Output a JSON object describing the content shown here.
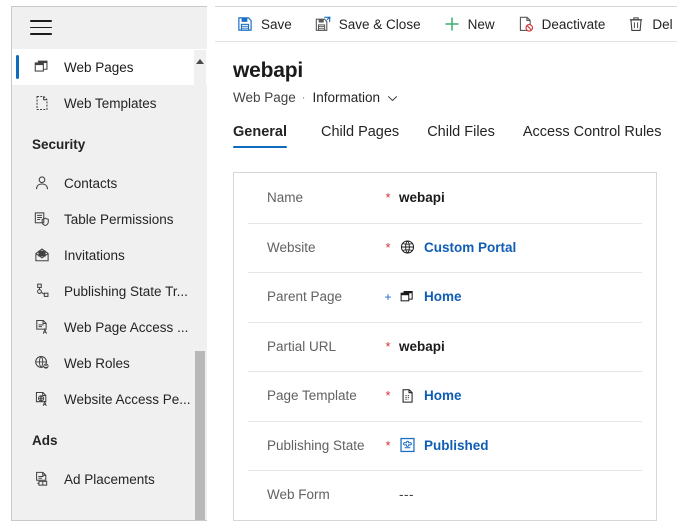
{
  "sidebar": {
    "menu_icon": "hamburger-icon",
    "items": [
      {
        "type": "item",
        "label": "Web Pages",
        "icon": "web-pages-icon",
        "selected": true
      },
      {
        "type": "item",
        "label": "Web Templates",
        "icon": "web-templates-icon",
        "selected": false
      },
      {
        "type": "group",
        "label": "Security"
      },
      {
        "type": "item",
        "label": "Contacts",
        "icon": "contact-person-icon",
        "selected": false
      },
      {
        "type": "item",
        "label": "Table  Permissions",
        "icon": "table-permissions-icon",
        "selected": false
      },
      {
        "type": "item",
        "label": "Invitations",
        "icon": "invitations-icon",
        "selected": false
      },
      {
        "type": "item",
        "label": "Publishing State Tr...",
        "icon": "publishing-state-transition-icon",
        "selected": false
      },
      {
        "type": "item",
        "label": "Web Page Access ...",
        "icon": "web-page-access-icon",
        "selected": false
      },
      {
        "type": "item",
        "label": "Web Roles",
        "icon": "web-roles-icon",
        "selected": false
      },
      {
        "type": "item",
        "label": "Website Access Pe...",
        "icon": "website-access-permission-icon",
        "selected": false
      },
      {
        "type": "group",
        "label": "Ads"
      },
      {
        "type": "item",
        "label": "Ad Placements",
        "icon": "ad-placements-icon",
        "selected": false
      }
    ],
    "scrollbar": {
      "up_arrow": "scroll-up-arrow-icon"
    }
  },
  "commandbar": {
    "buttons": [
      {
        "label": "Save",
        "icon": "save-icon"
      },
      {
        "label": "Save & Close",
        "icon": "save-and-close-icon"
      },
      {
        "label": "New",
        "icon": "plus-icon"
      },
      {
        "label": "Deactivate",
        "icon": "deactivate-icon"
      },
      {
        "label": "Del",
        "icon": "trash-icon"
      }
    ]
  },
  "record": {
    "title": "webapi",
    "entity": "Web Page",
    "separator": "·",
    "form_name": "Information",
    "form_chevron": "chevron-down-icon"
  },
  "tabs": [
    {
      "label": "General",
      "active": true
    },
    {
      "label": "Child Pages",
      "active": false
    },
    {
      "label": "Child Files",
      "active": false
    },
    {
      "label": "Access Control Rules",
      "active": false
    }
  ],
  "form": {
    "fields": [
      {
        "label": "Name",
        "marker": "*",
        "marker_type": "required",
        "value": "webapi",
        "value_type": "text",
        "icon": null
      },
      {
        "label": "Website",
        "marker": "*",
        "marker_type": "required",
        "value": "Custom Portal",
        "value_type": "lookup",
        "icon": "globe-icon"
      },
      {
        "label": "Parent Page",
        "marker": "+",
        "marker_type": "recommended",
        "value": "Home",
        "value_type": "lookup",
        "icon": "web-pages-icon"
      },
      {
        "label": "Partial URL",
        "marker": "*",
        "marker_type": "required",
        "value": "webapi",
        "value_type": "text",
        "icon": null
      },
      {
        "label": "Page Template",
        "marker": "*",
        "marker_type": "required",
        "value": "Home",
        "value_type": "lookup",
        "icon": "page-template-icon"
      },
      {
        "label": "Publishing State",
        "marker": "*",
        "marker_type": "required",
        "value": "Published",
        "value_type": "lookup",
        "icon": "publishing-state-icon"
      },
      {
        "label": "Web Form",
        "marker": "",
        "marker_type": "none",
        "value": "---",
        "value_type": "empty",
        "icon": null
      }
    ]
  },
  "colors": {
    "accent": "#0f6cbd",
    "link": "#0f5db5",
    "required": "#d13438",
    "recommended": "#2266cc",
    "sidebar_bg": "#f0f0f0",
    "border": "#d6d6d6"
  }
}
